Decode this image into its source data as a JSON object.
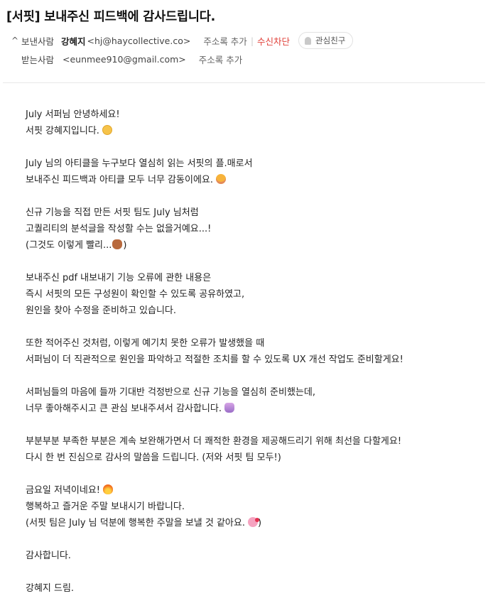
{
  "email": {
    "subject": "[서핏] 보내주신 피드백에 감사드립니다.",
    "from": {
      "label": "보낸사람",
      "name": "강혜지",
      "address": "<hj@haycollective.co>",
      "add_contact": "주소록 추가",
      "separator": "|",
      "block": "수신차단",
      "vip": "관심친구"
    },
    "to": {
      "label": "받는사람",
      "address": "<eunmee910@gmail.com>",
      "add_contact": "주소록 추가"
    },
    "body": {
      "p1": [
        "July 서퍼님 안녕하세요!",
        "서핏 강혜지입니다."
      ],
      "p2": [
        "July 님의 아티클을 누구보다 열심히 읽는 서핏의 플.매로서",
        "보내주신 피드백과 아티클 모두 너무 감동이에요."
      ],
      "p3": [
        "신규 기능을 직접 만든 서핏 팀도 July 님처럼",
        "고퀄리티의 분석글을 작성할 수는 없을거예요...!",
        "(그것도 이렇게 빨리..."
      ],
      "p3_close": ")",
      "p4": [
        "보내주신 pdf 내보내기 기능 오류에 관한 내용은",
        "즉시 서핏의 모든 구성원이 확인할 수 있도록 공유하였고,",
        "원인을 찾아 수정을 준비하고 있습니다."
      ],
      "p5": [
        "또한 적어주신 것처럼, 이렇게 예기치 못한 오류가 발생했을 때",
        "서퍼님이 더 직관적으로 원인을 파악하고 적절한 조치를 할 수 있도록 UX 개선 작업도 준비할게요!"
      ],
      "p6": [
        "서퍼님들의 마음에 들까 기대반 걱정반으로 신규 기능을 열심히 준비했는데,",
        "너무 좋아해주시고 큰 관심 보내주셔서 감사합니다."
      ],
      "p7": [
        "부분부분 부족한 부분은 계속 보완해가면서 더 쾌적한 환경을 제공해드리기 위해 최선을 다할게요!",
        "다시 한 번 진심으로 감사의 말씀을 드립니다. (저와 서핏 팀 모두!)"
      ],
      "p8": [
        "금요일 저녁이네요!",
        "행복하고 즐거운 주말 보내시기 바랍니다.",
        "(서핏 팀은 July 님 덕분에 행복한 주말을 보낼 것 같아요."
      ],
      "p8_close": ")",
      "p9": "감사합니다.",
      "p10": "강혜지 드림."
    },
    "emojis": {
      "smile": "smiling-face-emoji",
      "moved": "pleading-face-emoji",
      "monkey": "see-no-evil-monkey-emoji",
      "pray": "folded-hands-emoji",
      "fire": "fire-emoji",
      "kiss": "kissing-heart-emoji"
    }
  }
}
